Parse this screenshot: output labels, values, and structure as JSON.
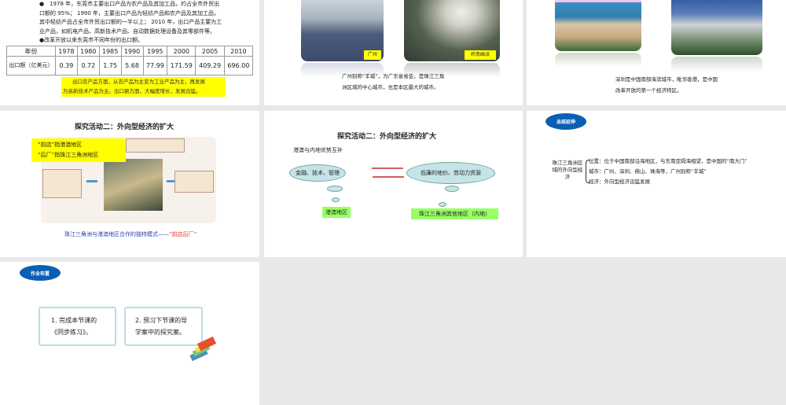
{
  "slide1": {
    "lines": [
      "●　1978 年，东莞市主要出口产品为农产品及其加工品，约占全市外贸出",
      "口额的 95%； 1990 年，主要出口产品为轻纺产品和农产品及其加工品，",
      "其中轻纺产品占全市外贸出口额的一半以上； 2010 年，出口产品主要为工",
      "业产品，如机电产品、高新技术产品、自动数据处理设备及其零部件等。",
      "●改革开放以来东莞市不同年份的出口额。"
    ],
    "table": {
      "header": [
        "年份",
        "1978",
        "1980",
        "1985",
        "1990",
        "1995",
        "2000",
        "2005",
        "2010"
      ],
      "row_label": "出口额（亿美元）",
      "values": [
        "0.39",
        "0.72",
        "1.75",
        "5.68",
        "77.99",
        "171.59",
        "409.29",
        "696.00"
      ]
    },
    "note": [
      "出口农产品方面，从农产品为主变为工业产品为主，再发展",
      "为高新技术产品为主。出口额方面，大幅度增长，发展迅猛。"
    ]
  },
  "slide2": {
    "label1": "广州",
    "label2": "岭南画派",
    "caption": [
      "广州别称“羊城”，为广东省省会，是珠江三角",
      "洲区域的中心城市，也是本区最大的城市。"
    ]
  },
  "slide3": {
    "caption": [
      "深圳是中国南部海滨城市，毗邻香港，是中国",
      "改革开放的第一个经济特区。"
    ]
  },
  "slide4": {
    "title": "探究活动二：外向型经济的扩大",
    "box": [
      "“前店”指港澳地区",
      "“后厂”指珠江三角洲地区"
    ],
    "caption": "珠江三角洲与港澳地区合作的独特模式——",
    "caption_red": "“前店后厂”"
  },
  "slide5": {
    "title": "探究活动二：外向型经济的扩大",
    "subtitle": "港澳与内地优势互补",
    "bubble1": "金融、技术、管理",
    "bubble2": "低廉的地价、劳动力资源",
    "label1": "港澳地区",
    "label2": "珠江三角洲其他地区（内地）"
  },
  "slide6": {
    "pill": "总结延伸",
    "left": "珠江三角洲区域的外向型经济",
    "items": [
      "位置：位于中国南部沿海地区，与东南亚隔海相望，是中国的“南大门”",
      "城市：广州、深圳、佛山、珠海等，广州别称“羊城”",
      "经济：外向型经济迅猛发展"
    ]
  },
  "slide7": {
    "pill": "作业布置",
    "box1": [
      "1. 完成本节课的",
      "《同步练习》。"
    ],
    "box2": [
      "2. 预习下节课的导",
      "学案中的探究案。"
    ]
  }
}
